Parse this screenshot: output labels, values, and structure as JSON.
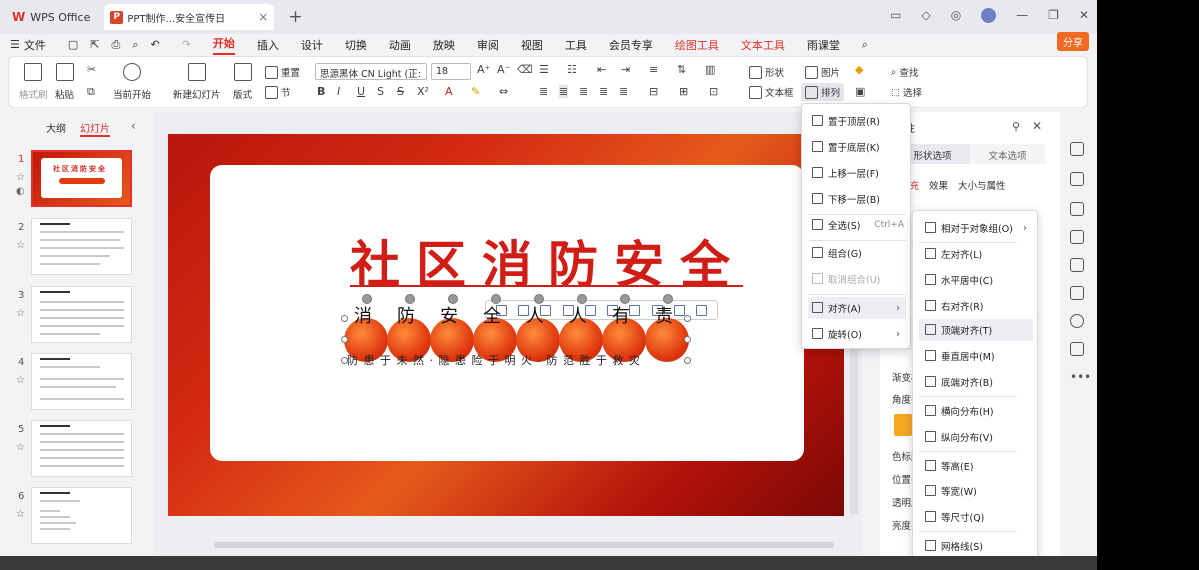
{
  "titlebar": {
    "app_name": "WPS Office",
    "doc_tab": "PPT制作...安全宣传日"
  },
  "menu": {
    "items": [
      "文件",
      "开始",
      "插入",
      "设计",
      "切换",
      "动画",
      "放映",
      "审阅",
      "视图",
      "工具",
      "会员专享",
      "绘图工具",
      "文本工具",
      "雨课堂"
    ],
    "share": "分享"
  },
  "ribbon": {
    "format_painter": "格式刷",
    "paste": "粘贴",
    "from_current": "当前开始",
    "new_slide": "新建幻灯片",
    "layout": "版式",
    "section": "节",
    "reset": "重置",
    "font_name": "思源黑体 CN Light (正:",
    "font_size": "18",
    "shape": "形状",
    "picture": "图片",
    "find": "查找",
    "select": "选择",
    "textbox": "文本框",
    "arrange": "排列"
  },
  "left_panel": {
    "tab_outline": "大纲",
    "tab_slides": "幻灯片",
    "slides": [
      "1",
      "2",
      "3",
      "4",
      "5",
      "6"
    ]
  },
  "slide": {
    "title": "社区消防安全",
    "chars": [
      "消",
      "防",
      "安",
      "全",
      "人",
      "人",
      "有",
      "责"
    ],
    "subtitle": "防 患 于 未 然 · 隐 患 险 于 明 火 · 防 范 胜 于 救 灾"
  },
  "right_panel": {
    "title": "属性",
    "tab_shape": "形状选项",
    "tab_text": "文本选项",
    "sub_fill": "填充",
    "sub_effect": "效果",
    "sub_size": "大小与属性",
    "labels": [
      "渐变样",
      "角度(",
      "色标颜",
      "位置(",
      "透明度",
      "亮度("
    ]
  },
  "arrange_menu": {
    "items": [
      {
        "label": "置于顶层(R)",
        "shortcut": ""
      },
      {
        "label": "置于底层(K)",
        "shortcut": ""
      },
      {
        "label": "上移一层(F)",
        "shortcut": ""
      },
      {
        "label": "下移一层(B)",
        "shortcut": ""
      },
      {
        "label": "全选(S)",
        "shortcut": "Ctrl+A"
      },
      {
        "label": "组合(G)",
        "shortcut": ""
      },
      {
        "label": "取消组合(U)",
        "shortcut": ""
      },
      {
        "label": "对齐(A)",
        "shortcut": ""
      },
      {
        "label": "旋转(O)",
        "shortcut": ""
      }
    ]
  },
  "align_submenu": {
    "items": [
      "相对于对象组(O)",
      "左对齐(L)",
      "水平居中(C)",
      "右对齐(R)",
      "顶端对齐(T)",
      "垂直居中(M)",
      "底端对齐(B)",
      "横向分布(H)",
      "纵向分布(V)",
      "等高(E)",
      "等宽(W)",
      "等尺寸(Q)",
      "网格线(S)"
    ]
  }
}
